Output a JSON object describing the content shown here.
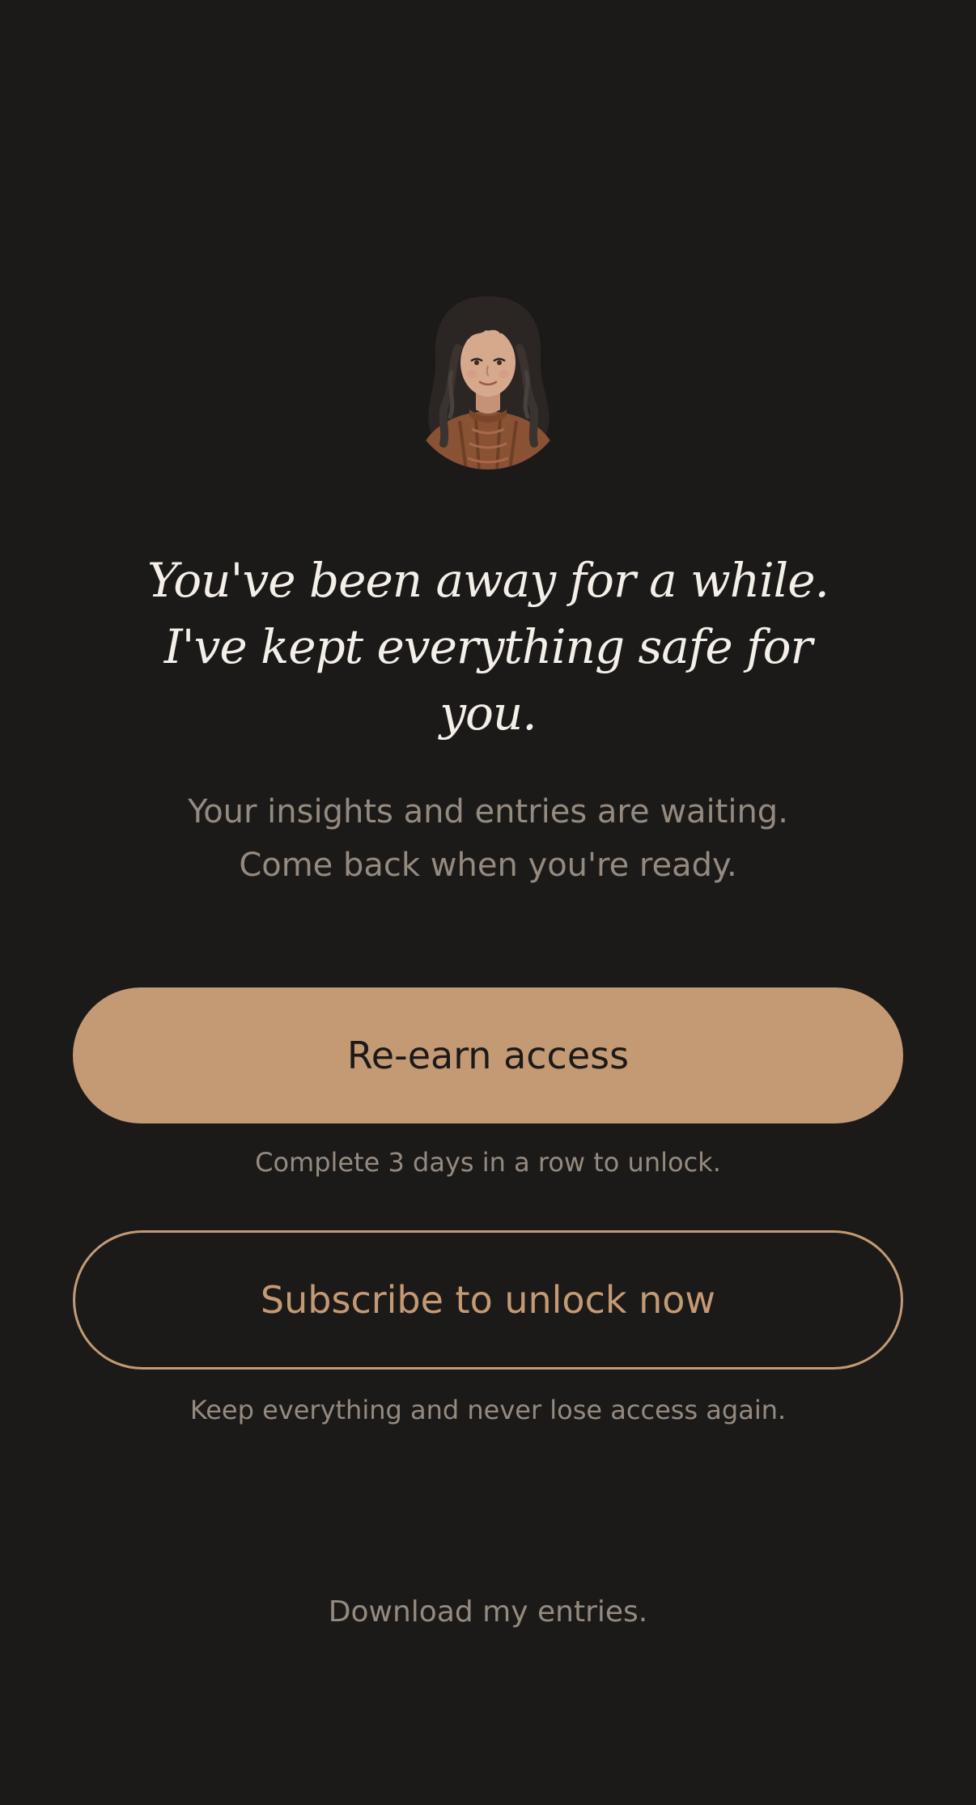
{
  "avatar": {
    "icon": "companion-avatar-illustration"
  },
  "headline": "You've been away for a while. I've kept everything safe for you.",
  "subtext": {
    "line1": "Your insights and entries are waiting.",
    "line2": "Come back when you're ready."
  },
  "primary_action": {
    "label": "Re-earn access",
    "caption": "Complete 3 days in a row to unlock."
  },
  "secondary_action": {
    "label": "Subscribe to unlock now",
    "caption": "Keep everything and never lose access again."
  },
  "download_link": "Download my entries.",
  "colors": {
    "background": "#1c1a19",
    "accent": "#c49a74",
    "headline": "#f4efe8",
    "muted_text": "#948a7f"
  }
}
